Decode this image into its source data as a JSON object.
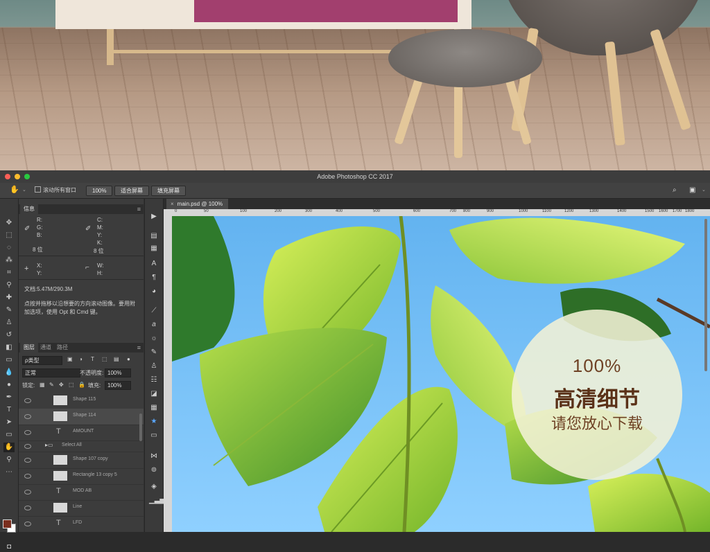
{
  "window": {
    "title": "Adobe Photoshop CC 2017"
  },
  "options_bar": {
    "scroll_all_label": "滚动所有窗口",
    "zoom_button": "100%",
    "fit_screen_button": "适合屏幕",
    "fill_screen_button": "填充屏幕"
  },
  "info_panel": {
    "tab": "信息",
    "r": "R:",
    "g": "G:",
    "b": "B:",
    "c": "C:",
    "m": "M:",
    "y": "Y:",
    "k": "K:",
    "bits_left": "8 位",
    "bits_right": "8 位",
    "x": "X:",
    "y2": "Y:",
    "w": "W:",
    "h": "H:",
    "doc": "文档:5.47M/290.3M",
    "help_line1": "点按并拖移以沿想要的方向滚动图像。要用附",
    "help_line2": "加选项，使用 Opt 和 Cmd 键。"
  },
  "layers_panel": {
    "tabs": [
      "图层",
      "通道",
      "路径"
    ],
    "filter_kind": "ρ类型",
    "blend_mode": "正常",
    "opacity_label": "不透明度:",
    "opacity_value": "100%",
    "lock_label": "锁定:",
    "fill_label": "填充:",
    "fill_value": "100%",
    "layers": [
      {
        "name": "Shape 115",
        "kind": "shape"
      },
      {
        "name": "Shape 114",
        "kind": "shape"
      },
      {
        "name": "AMOUNT",
        "kind": "text"
      },
      {
        "name": "Select All",
        "kind": "group"
      },
      {
        "name": "Shape 107 copy",
        "kind": "shape"
      },
      {
        "name": "Rectangle 13 copy 5",
        "kind": "shape"
      },
      {
        "name": "MOD AB",
        "kind": "text"
      },
      {
        "name": "Line",
        "kind": "shape"
      },
      {
        "name": "LFD",
        "kind": "text"
      }
    ]
  },
  "document": {
    "tab_title": "main.psd @ 100%",
    "ruler_marks": [
      "0",
      "50",
      "100",
      "200",
      "300",
      "400",
      "500",
      "600",
      "700",
      "800",
      "900",
      "1000",
      "1100",
      "1200",
      "1300",
      "1400",
      "1500",
      "1600",
      "1700",
      "1800"
    ]
  },
  "badge": {
    "line1": "100%",
    "line2": "高清细节",
    "line3": "请您放心下载"
  },
  "colors": {
    "foreground": "#7a2e1e",
    "background": "#ffffff",
    "badge_text": "#5a3118",
    "sky": "#63b3f0",
    "leaf": "#9ccf3a"
  }
}
